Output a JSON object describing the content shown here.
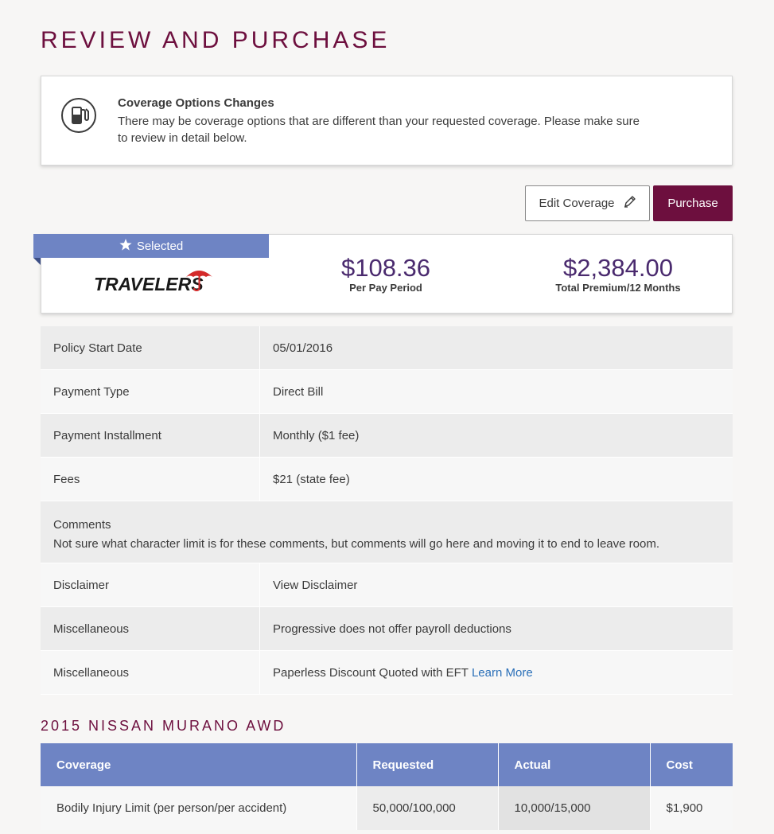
{
  "page": {
    "title": "REVIEW AND PURCHASE"
  },
  "notice": {
    "icon": "gas-pump-icon",
    "title": "Coverage Options Changes",
    "body": "There may be coverage options that are different than your requested coverage. Please make sure to review in detail below."
  },
  "actions": {
    "edit_label": "Edit Coverage",
    "purchase_label": "Purchase"
  },
  "quote": {
    "badge": "Selected",
    "carrier_logo_text": "TRAVELERS",
    "per_period_amount": "$108.36",
    "per_period_caption": "Per Pay Period",
    "total_amount": "$2,384.00",
    "total_caption": "Total Premium/12 Months"
  },
  "details": {
    "policy_start": {
      "label": "Policy Start Date",
      "value": "05/01/2016"
    },
    "payment_type": {
      "label": "Payment Type",
      "value": "Direct Bill"
    },
    "installment": {
      "label": "Payment Installment",
      "value": "Monthly ($1 fee)"
    },
    "fees": {
      "label": "Fees",
      "value": "$21 (state fee)"
    },
    "comments": {
      "label": "Comments",
      "value": "Not sure what character limit is for these comments, but comments will go here and moving it to end to leave room."
    },
    "disclaimer": {
      "label": "Disclaimer",
      "value": "View Disclaimer"
    },
    "misc1": {
      "label": "Miscellaneous",
      "value": "Progressive does not offer payroll deductions"
    },
    "misc2": {
      "label": "Miscellaneous",
      "value": "Paperless Discount Quoted with EFT",
      "link": "Learn More"
    }
  },
  "vehicle": {
    "title": "2015 NISSAN MURANO AWD",
    "columns": [
      "Coverage",
      "Requested",
      "Actual",
      "Cost"
    ],
    "rows": [
      [
        "Bodily Injury Limit (per person/per accident)",
        "50,000/100,000",
        "10,000/15,000",
        "$1,900"
      ]
    ]
  },
  "colors": {
    "brand": "#6d0f3e",
    "accent": "#6e84c4",
    "link": "#2a6fb8",
    "price": "#4a2a6e"
  }
}
